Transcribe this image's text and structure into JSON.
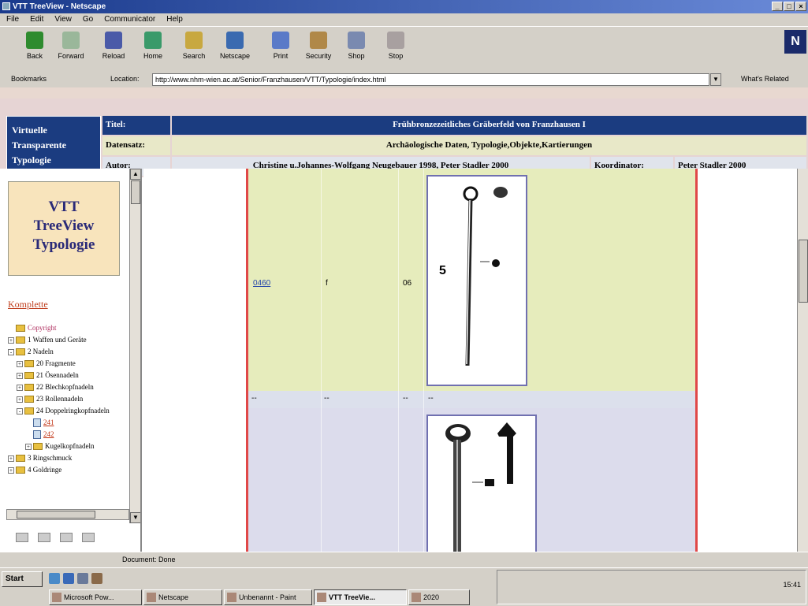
{
  "window": {
    "title": "VTT TreeView - Netscape",
    "controls": [
      "_",
      "□",
      "×"
    ]
  },
  "menu": [
    "File",
    "Edit",
    "View",
    "Go",
    "Communicator",
    "Help"
  ],
  "toolbar": {
    "buttons": [
      {
        "label": "Back",
        "icon": "back-arrow-icon",
        "color": "#2e8b2e"
      },
      {
        "label": "Forward",
        "icon": "forward-arrow-icon",
        "color": "#9ab79a"
      },
      {
        "label": "Reload",
        "icon": "reload-icon",
        "color": "#4a5aa8"
      },
      {
        "label": "Home",
        "icon": "home-icon",
        "color": "#3a9a6a"
      },
      {
        "label": "Search",
        "icon": "search-icon",
        "color": "#c8a840"
      },
      {
        "label": "Netscape",
        "icon": "netscape-icon",
        "color": "#3a6ab0"
      },
      {
        "label": "Print",
        "icon": "print-icon",
        "color": "#5a7ac8"
      },
      {
        "label": "Security",
        "icon": "security-icon",
        "color": "#b08848"
      },
      {
        "label": "Shop",
        "icon": "shop-icon",
        "color": "#7a8ab0"
      },
      {
        "label": "Stop",
        "icon": "stop-icon",
        "color": "#a8a0a0"
      }
    ],
    "logo": "N"
  },
  "location": {
    "bookmarks": "Bookmarks",
    "location_label": "Location:",
    "url": "http://www.nhm-wien.ac.at/Senior/Franzhausen/VTT/Typologie/index.html",
    "whats_related": "What's Related"
  },
  "header": {
    "logo_lines": [
      "Virtuelle",
      "Transparente",
      "Typologie"
    ],
    "titel_label": "Titel:",
    "titel_value": "Frühbronzezeitliches Gräberfeld von Franzhausen I",
    "datensatz_label": "Datensatz:",
    "datensatz_value": "Archäologische Daten, Typologie,Objekte,Kartierungen",
    "autor_label": "Autor:",
    "autor_value": "Christine u.Johannes-Wolfgang Neugebauer 1998, Peter Stadler 2000",
    "koordinator_label": "Koordinator:",
    "koordinator_value": "Peter Stadler 2000"
  },
  "sidebar": {
    "box_lines": [
      "VTT",
      "TreeView",
      "Typologie"
    ],
    "komplette": "Komplette",
    "tree": [
      {
        "label": "Copyright",
        "level": 0,
        "toggle": "",
        "kind": "folder",
        "style": "pink"
      },
      {
        "label": "1 Waffen und Geräte",
        "level": 0,
        "toggle": "+",
        "kind": "folder",
        "style": ""
      },
      {
        "label": "2 Nadeln",
        "level": 0,
        "toggle": "-",
        "kind": "folder",
        "style": ""
      },
      {
        "label": "20 Fragmente",
        "level": 1,
        "toggle": "+",
        "kind": "folder",
        "style": ""
      },
      {
        "label": "21 Ösennadeln",
        "level": 1,
        "toggle": "+",
        "kind": "folder",
        "style": ""
      },
      {
        "label": "22 Blechkopfnadeln",
        "level": 1,
        "toggle": "+",
        "kind": "folder",
        "style": ""
      },
      {
        "label": "23 Rollennadeln",
        "level": 1,
        "toggle": "+",
        "kind": "folder",
        "style": ""
      },
      {
        "label": "24 Doppelringkopfnadeln",
        "level": 1,
        "toggle": "-",
        "kind": "folder",
        "style": ""
      },
      {
        "label": "241",
        "level": 2,
        "toggle": "",
        "kind": "doc",
        "style": "red"
      },
      {
        "label": "242",
        "level": 2,
        "toggle": "",
        "kind": "doc",
        "style": "red"
      },
      {
        "label": "Kugelkopfnadeln",
        "level": 2,
        "toggle": "+",
        "kind": "folder",
        "style": ""
      },
      {
        "label": "3 Ringschmuck",
        "level": 0,
        "toggle": "+",
        "kind": "folder",
        "style": ""
      },
      {
        "label": "4 Goldringe",
        "level": 0,
        "toggle": "+",
        "kind": "folder",
        "style": ""
      }
    ]
  },
  "table": {
    "row1": {
      "link": "0460",
      "col2": "f",
      "col3": "06",
      "figure_number": "5"
    },
    "row2": {
      "cells": [
        "--",
        "--",
        "--",
        "--"
      ]
    }
  },
  "status": {
    "text": "Document: Done"
  },
  "taskbar": {
    "start": "Start",
    "tasks": [
      {
        "label": "Microsoft Pow...",
        "active": false
      },
      {
        "label": "Netscape",
        "active": false
      },
      {
        "label": "Unbenannt - Paint",
        "active": false
      },
      {
        "label": "VTT TreeVie...",
        "active": true
      },
      {
        "label": "2020",
        "active": false
      }
    ],
    "clock": "15:41"
  }
}
